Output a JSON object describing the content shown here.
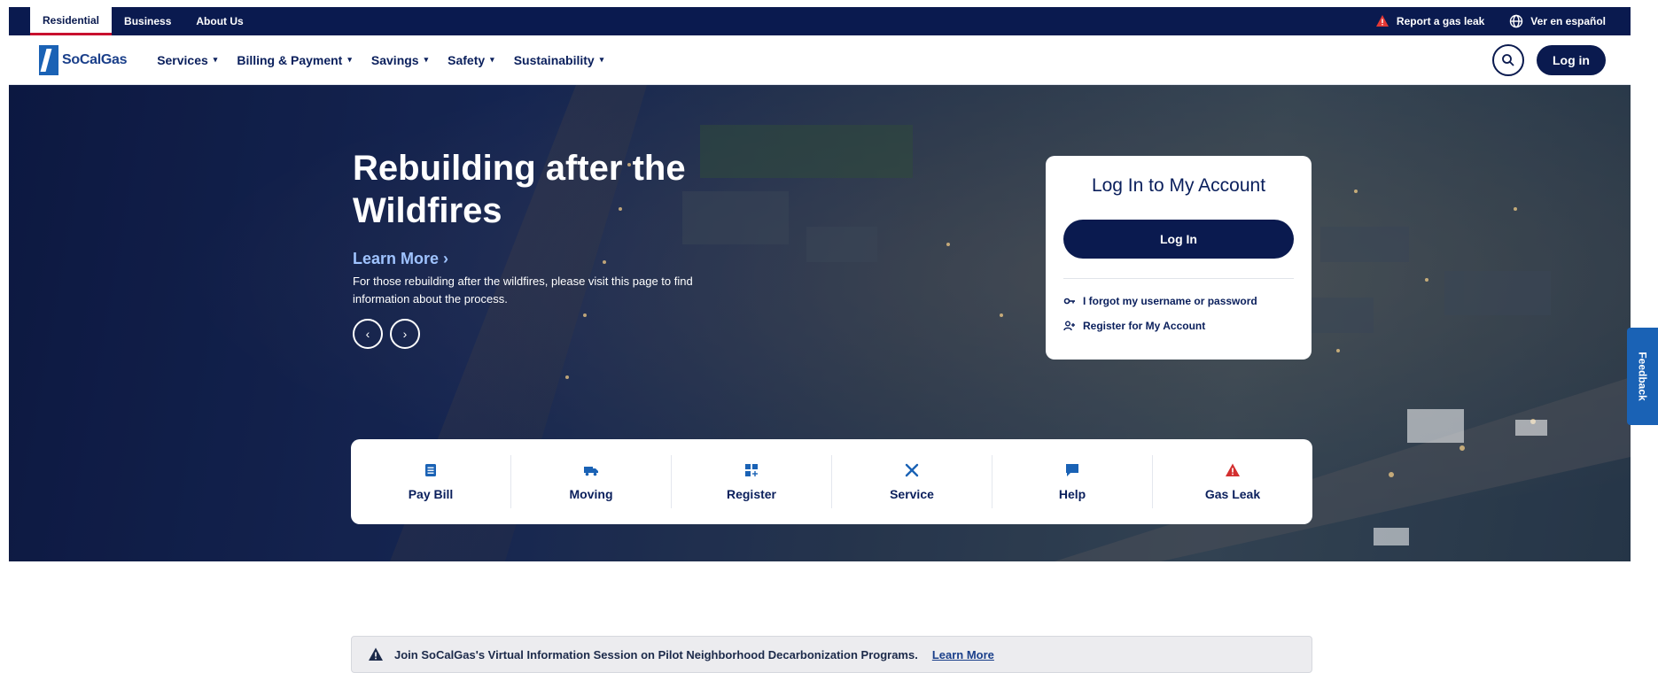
{
  "topbar": {
    "tabs": [
      {
        "label": "Residential"
      },
      {
        "label": "Business"
      },
      {
        "label": "About Us"
      }
    ],
    "report_gas_leak": "Report a gas leak",
    "spanish": "Ver en español"
  },
  "nav": {
    "brand": "SoCalGas",
    "items": [
      {
        "label": "Services"
      },
      {
        "label": "Billing & Payment"
      },
      {
        "label": "Savings"
      },
      {
        "label": "Safety"
      },
      {
        "label": "Sustainability"
      }
    ],
    "login_label": "Log in"
  },
  "hero": {
    "title": "Rebuilding after the Wildfires",
    "learn_more": "Learn More ›",
    "description": "For those rebuilding after the wildfires, please visit this page to find information about the process.",
    "prev": "‹",
    "next": "›"
  },
  "login_card": {
    "title": "Log In to My Account",
    "button": "Log In",
    "forgot": "I forgot my username or password",
    "register": "Register for My Account"
  },
  "feedback": "Feedback",
  "quick_actions": [
    {
      "label": "Pay Bill",
      "icon": "bill-icon"
    },
    {
      "label": "Moving",
      "icon": "truck-icon"
    },
    {
      "label": "Register",
      "icon": "grid-plus-icon"
    },
    {
      "label": "Service",
      "icon": "tools-icon"
    },
    {
      "label": "Help",
      "icon": "chat-icon"
    },
    {
      "label": "Gas Leak",
      "icon": "warning-icon"
    }
  ],
  "alert": {
    "text": "Join SoCalGas's Virtual Information Session on Pilot Neighborhood Decarbonization Programs.",
    "link": "Learn More"
  },
  "colors": {
    "navy": "#0a1a4f",
    "brand_blue": "#1a62b5",
    "alert_red": "#d32f2f"
  }
}
